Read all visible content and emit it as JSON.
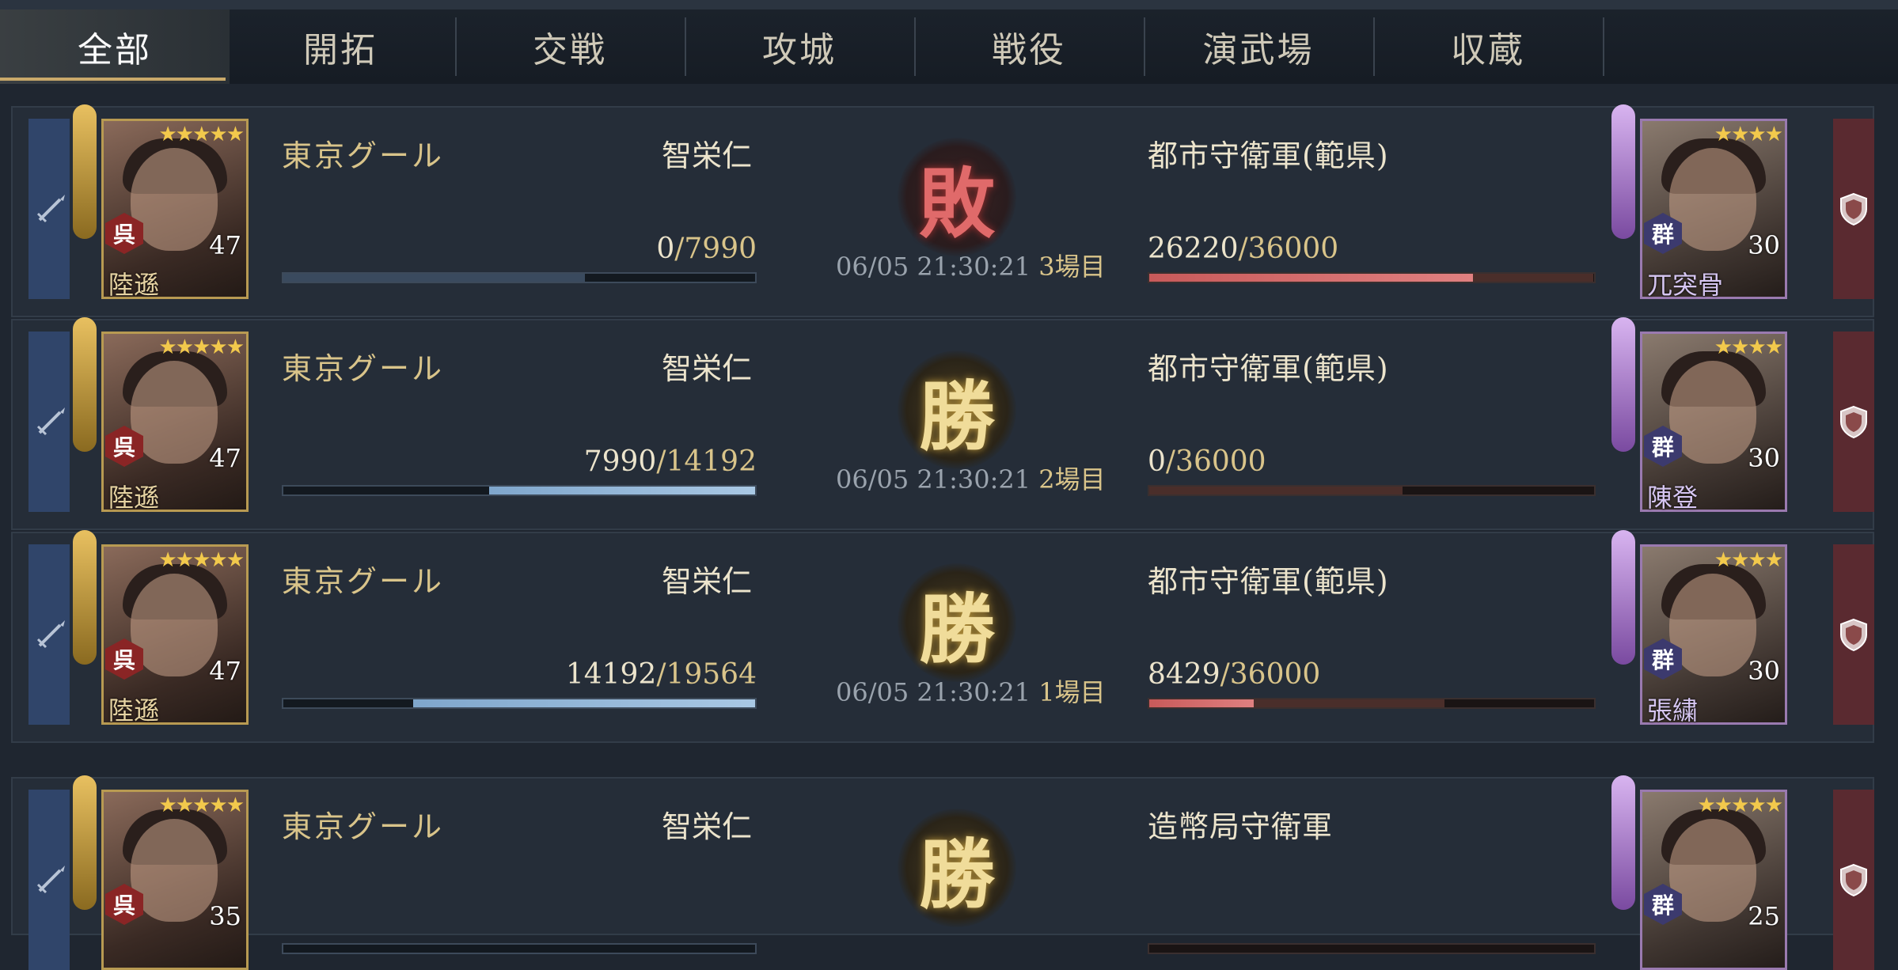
{
  "tabs": [
    {
      "label": "全部",
      "active": true
    },
    {
      "label": "開拓",
      "active": false
    },
    {
      "label": "交戦",
      "active": false
    },
    {
      "label": "攻城",
      "active": false
    },
    {
      "label": "戦役",
      "active": false
    },
    {
      "label": "演武場",
      "active": false
    },
    {
      "label": "収蔵",
      "active": false
    }
  ],
  "records": [
    {
      "guild": "東京グール",
      "player": "智栄仁",
      "attacker": {
        "name": "陸遜",
        "faction": "呉",
        "level": "47",
        "stars": "★★★★★",
        "troops_current": "0",
        "troops_max": "/7990",
        "fill": 0.0,
        "lost": 0.64
      },
      "result": "敗",
      "result_type": "lose",
      "time": "06/05 21:30:21",
      "round": "3場目",
      "enemy_name": "都市守衛軍(範県)",
      "defender": {
        "name": "兀突骨",
        "faction": "群",
        "level": "30",
        "stars": "★★★★",
        "troops_current": "26220",
        "troops_max": "/36000",
        "fill": 0.728,
        "lost": 0.27
      }
    },
    {
      "guild": "東京グール",
      "player": "智栄仁",
      "attacker": {
        "name": "陸遜",
        "faction": "呉",
        "level": "47",
        "stars": "★★★★★",
        "troops_current": "7990",
        "troops_max": "/14192",
        "fill": 0.563,
        "lost": 0.2
      },
      "result": "勝",
      "result_type": "win",
      "time": "06/05 21:30:21",
      "round": "2場目",
      "enemy_name": "都市守衛軍(範県)",
      "defender": {
        "name": "陳登",
        "faction": "群",
        "level": "30",
        "stars": "★★★★",
        "troops_current": "0",
        "troops_max": "/36000",
        "fill": 0.0,
        "lost": 0.57
      }
    },
    {
      "guild": "東京グール",
      "player": "智栄仁",
      "attacker": {
        "name": "陸遜",
        "faction": "呉",
        "level": "47",
        "stars": "★★★★★",
        "troops_current": "14192",
        "troops_max": "/19564",
        "fill": 0.725,
        "lost": 0.13
      },
      "result": "勝",
      "result_type": "win",
      "time": "06/05 21:30:21",
      "round": "1場目",
      "enemy_name": "都市守衛軍(範県)",
      "defender": {
        "name": "張繍",
        "faction": "群",
        "level": "30",
        "stars": "★★★★",
        "troops_current": "8429",
        "troops_max": "/36000",
        "fill": 0.234,
        "lost": 0.43
      }
    },
    {
      "guild": "東京グール",
      "player": "智栄仁",
      "attacker": {
        "name": "",
        "faction": "呉",
        "level": "35",
        "stars": "★★★★★",
        "troops_current": "",
        "troops_max": "",
        "fill": 0.0,
        "lost": 0.0
      },
      "result": "勝",
      "result_type": "win",
      "time": "",
      "round": "",
      "enemy_name": "造幣局守衛軍",
      "defender": {
        "name": "",
        "faction": "群",
        "level": "25",
        "stars": "★★★★★",
        "troops_current": "",
        "troops_max": "",
        "fill": 0.0,
        "lost": 0.0
      }
    }
  ]
}
